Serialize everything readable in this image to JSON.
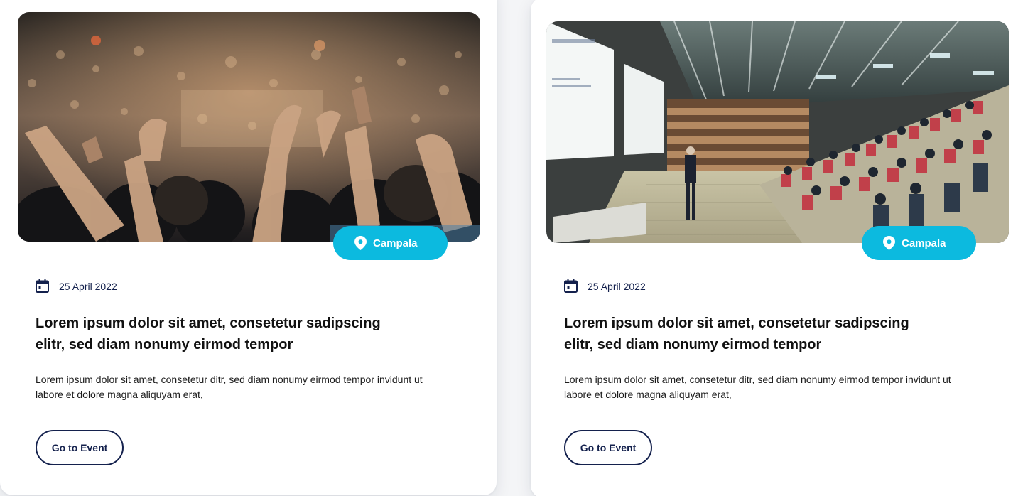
{
  "cards": [
    {
      "image_alt": "concert crowd with raised hands",
      "location": "Campala",
      "location_icon": "map-pin-icon",
      "date_icon": "calendar-icon",
      "date": "25 April 2022",
      "title": "Lorem ipsum dolor sit amet, consetetur sadipscing\n elitr, sed diam nonumy eirmod tempor",
      "description": "Lorem ipsum dolor sit amet, consetetur ditr, sed diam nonumy eirmod tempor invidunt ut labore et dolore magna aliquyam erat,",
      "button_label": "Go to Event"
    },
    {
      "image_alt": "speaker presenting in a lecture hall",
      "location": "Campala",
      "location_icon": "map-pin-icon",
      "date_icon": "calendar-icon",
      "date": "25 April 2022",
      "title": "Lorem ipsum dolor sit amet, consetetur sadipscing\n elitr, sed diam nonumy eirmod tempor",
      "description": "Lorem ipsum dolor sit amet, consetetur ditr, sed diam nonumy eirmod tempor invidunt ut labore et dolore magna aliquyam erat,",
      "button_label": "Go to Event"
    }
  ],
  "colors": {
    "badge": "#0cbadf",
    "navy": "#14214d",
    "card_bg": "#ffffff",
    "page_bg": "#f4f5f7"
  }
}
